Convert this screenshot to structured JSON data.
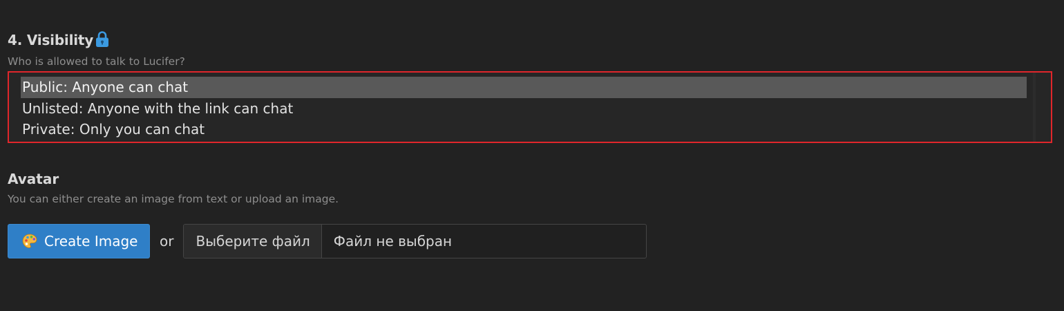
{
  "visibility": {
    "title": "4. Visibility",
    "lock_icon": "lock-icon",
    "lock_color": "#3b9ae1",
    "subtitle": "Who is allowed to talk to Lucifer?",
    "options": [
      "Public: Anyone can chat",
      "Unlisted: Anyone with the link can chat",
      "Private: Only you can chat"
    ],
    "selected_index": 0,
    "highlight_border_color": "#e0262b"
  },
  "avatar": {
    "title": "Avatar",
    "subtitle": "You can either create an image from text or upload an image.",
    "create_button": {
      "icon": "palette-icon",
      "label": "Create Image",
      "color": "#2f7fc7"
    },
    "or_label": "or",
    "file_input": {
      "button_label": "Выберите файл",
      "status": "Файл не выбран"
    }
  }
}
